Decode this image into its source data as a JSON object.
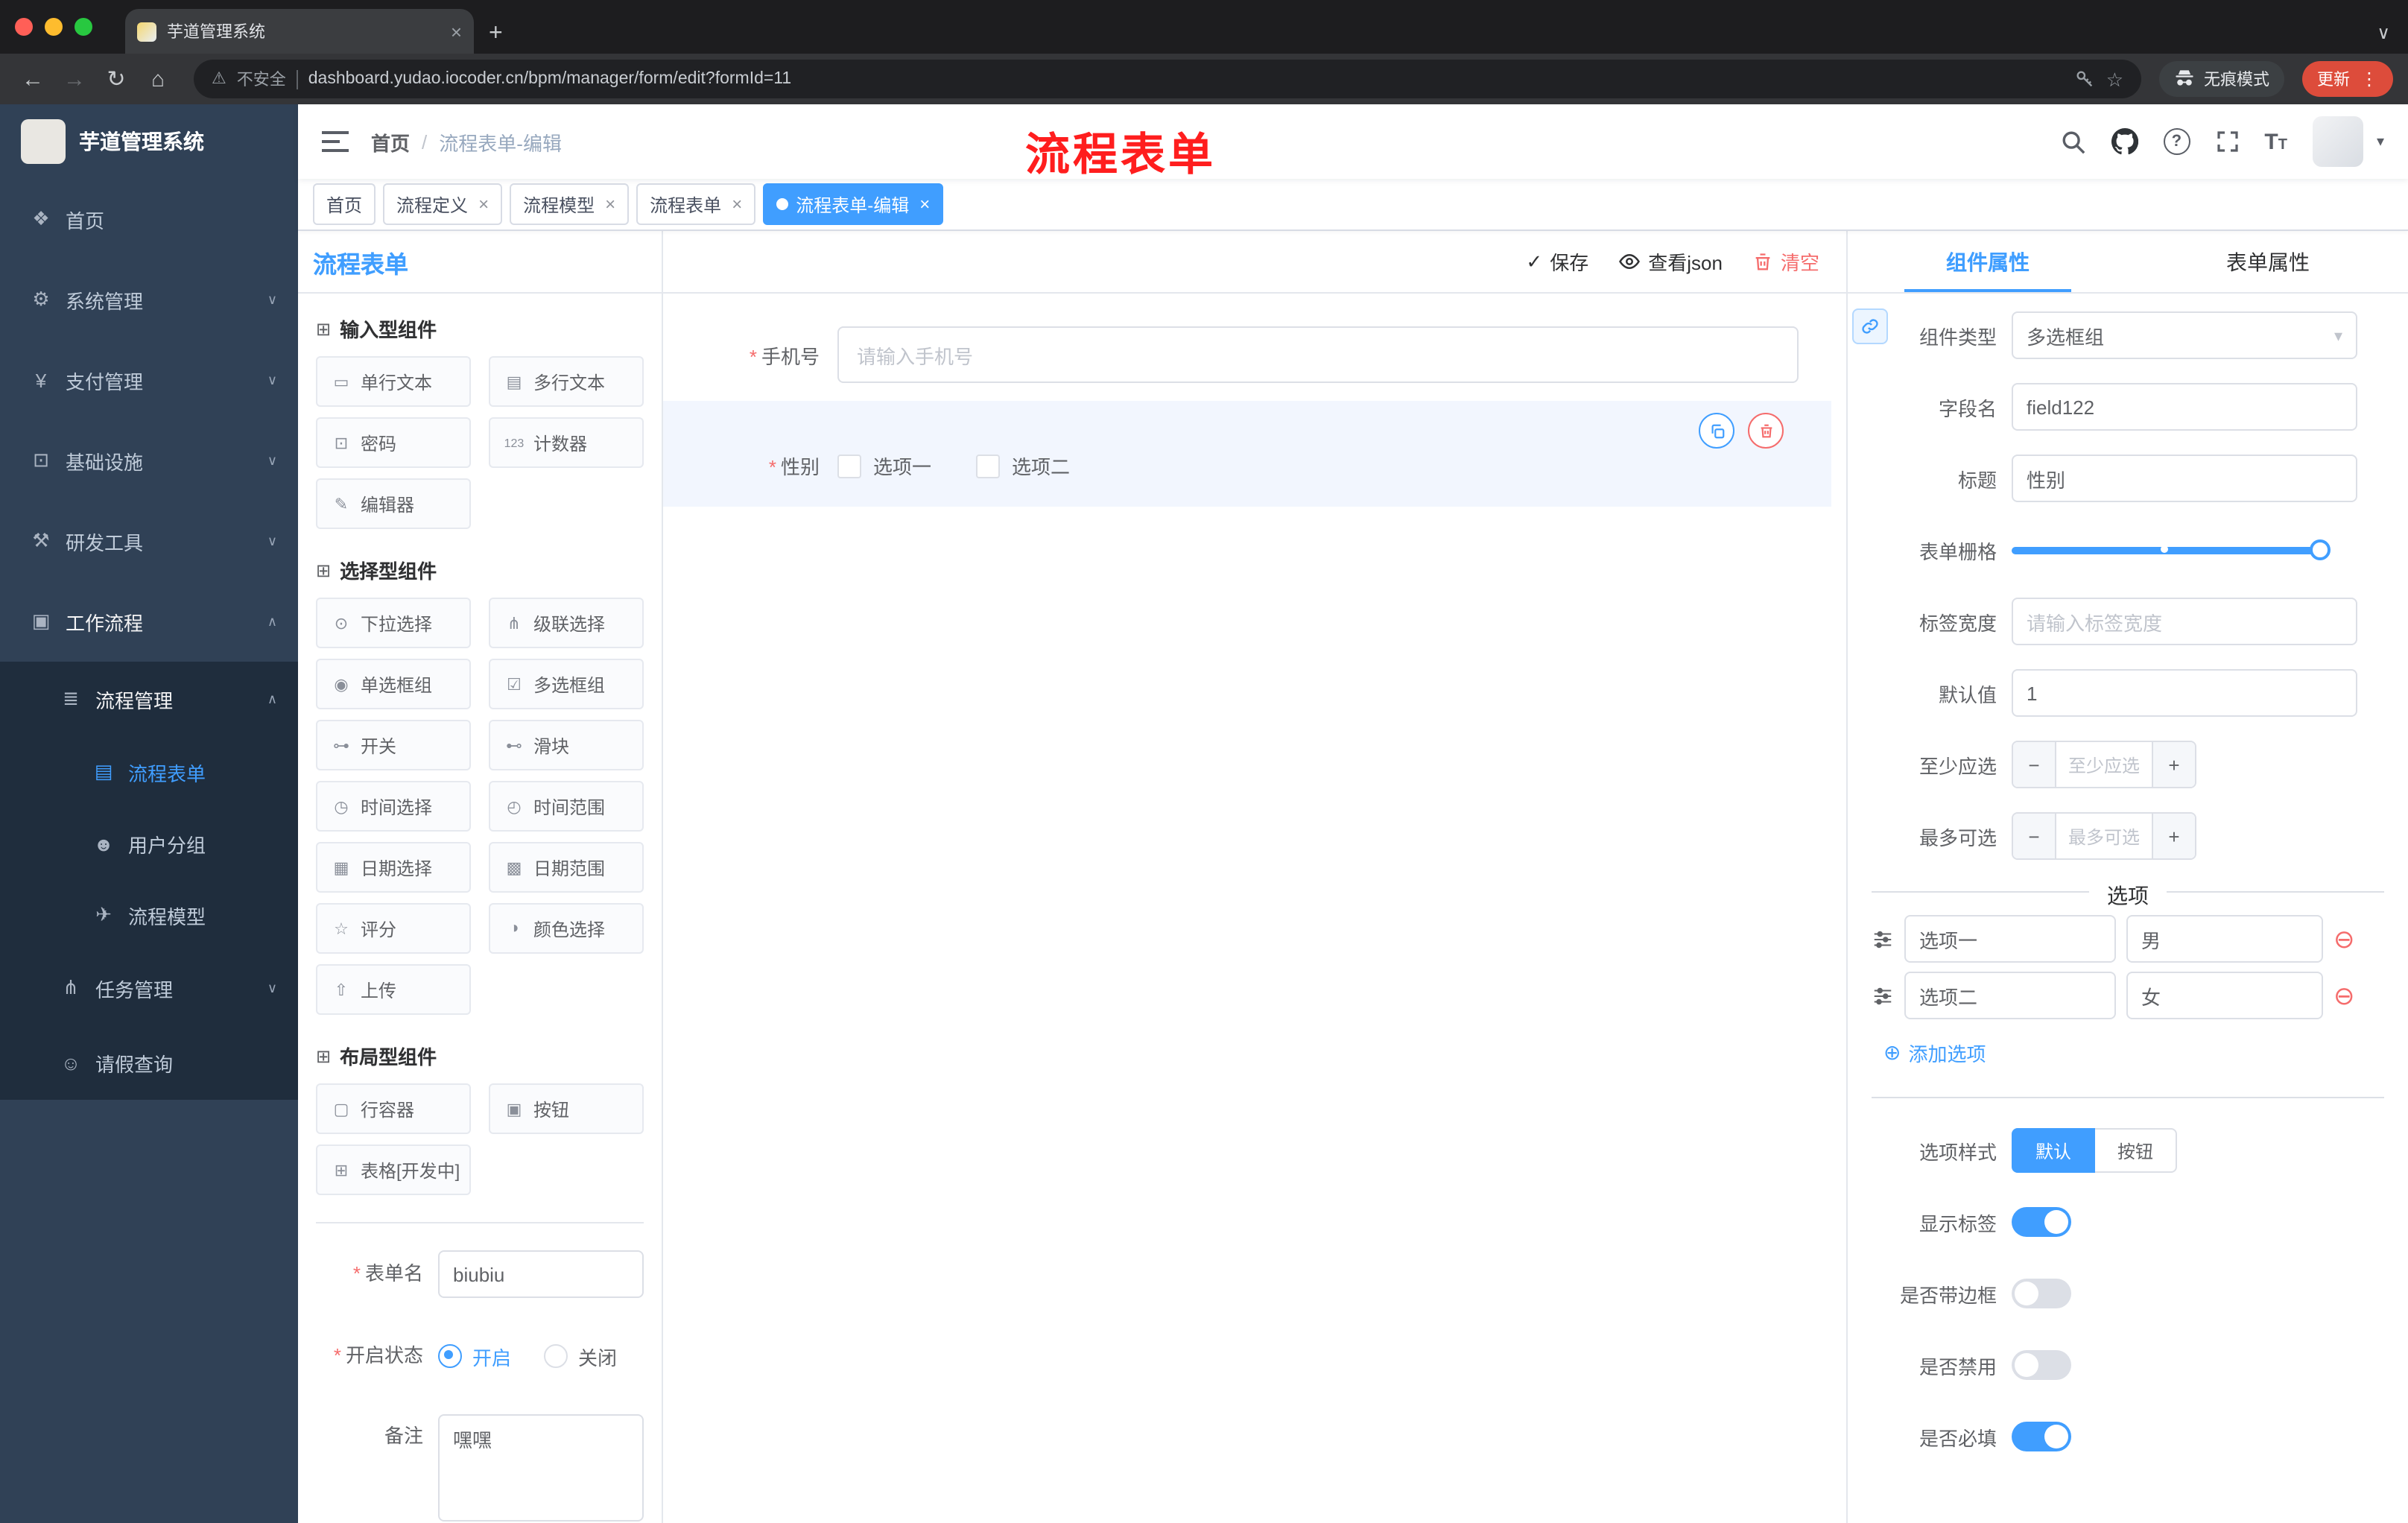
{
  "browser": {
    "tab_title": "芋道管理系统",
    "security_label": "不安全",
    "url": "dashboard.yudao.iocoder.cn/bpm/manager/form/edit?formId=11",
    "incognito_label": "无痕模式",
    "update_label": "更新"
  },
  "icons": {
    "back": "←",
    "forward": "→",
    "reload": "↻",
    "home": "⌂",
    "warning": "⚠",
    "star": "☆",
    "tab_search": "∨",
    "menu_dots": "⋮",
    "close": "×",
    "plus": "+",
    "minus": "−",
    "check": "✓",
    "caret_down": "▾",
    "question": "?",
    "text_size_big": "T",
    "text_size_small": "T",
    "add_circle": "⊕",
    "remove_circle": "⊖",
    "section": "⊞",
    "breadcrumb_sep": "/",
    "required": "*"
  },
  "watermark": "流程表单",
  "sidebar": {
    "logo_title": "芋道管理系统",
    "menu": [
      {
        "label": "首页",
        "icon": "❖",
        "arrow": ""
      },
      {
        "label": "系统管理",
        "icon": "⚙",
        "arrow": "∨"
      },
      {
        "label": "支付管理",
        "icon": "¥",
        "arrow": "∨"
      },
      {
        "label": "基础设施",
        "icon": "⊡",
        "arrow": "∨"
      },
      {
        "label": "研发工具",
        "icon": "⚒",
        "arrow": "∨"
      },
      {
        "label": "工作流程",
        "icon": "▣",
        "arrow": "∧"
      },
      {
        "label": "流程管理",
        "icon": "≣",
        "arrow": "∧"
      },
      {
        "label": "流程表单",
        "icon": "▤",
        "arrow": ""
      },
      {
        "label": "用户分组",
        "icon": "☻",
        "arrow": ""
      },
      {
        "label": "流程模型",
        "icon": "✈",
        "arrow": ""
      },
      {
        "label": "任务管理",
        "icon": "⋔",
        "arrow": "∨"
      },
      {
        "label": "请假查询",
        "icon": "☺",
        "arrow": ""
      }
    ]
  },
  "header": {
    "breadcrumb": {
      "home": "首页",
      "current": "流程表单-编辑"
    }
  },
  "tags": [
    {
      "label": "首页"
    },
    {
      "label": "流程定义"
    },
    {
      "label": "流程模型"
    },
    {
      "label": "流程表单"
    },
    {
      "label": "流程表单-编辑"
    }
  ],
  "palette": {
    "title": "流程表单",
    "input_section": "输入型组件",
    "input_items": [
      {
        "label": "单行文本",
        "icon": "▭"
      },
      {
        "label": "多行文本",
        "icon": "▤"
      },
      {
        "label": "密码",
        "icon": "⊡"
      },
      {
        "label": "计数器",
        "icon": "123"
      },
      {
        "label": "编辑器",
        "icon": "✎"
      }
    ],
    "select_section": "选择型组件",
    "select_items": [
      {
        "label": "下拉选择",
        "icon": "⊙"
      },
      {
        "label": "级联选择",
        "icon": "⋔"
      },
      {
        "label": "单选框组",
        "icon": "◉"
      },
      {
        "label": "多选框组",
        "icon": "☑"
      },
      {
        "label": "开关",
        "icon": "⊶"
      },
      {
        "label": "滑块",
        "icon": "⊷"
      },
      {
        "label": "时间选择",
        "icon": "◷"
      },
      {
        "label": "时间范围",
        "icon": "◴"
      },
      {
        "label": "日期选择",
        "icon": "▦"
      },
      {
        "label": "日期范围",
        "icon": "▩"
      },
      {
        "label": "评分",
        "icon": "☆"
      },
      {
        "label": "颜色选择",
        "icon": "◑"
      },
      {
        "label": "上传",
        "icon": "⇧"
      }
    ],
    "layout_section": "布局型组件",
    "layout_items": [
      {
        "label": "行容器",
        "icon": "▢"
      },
      {
        "label": "按钮",
        "icon": "▣"
      },
      {
        "label": "表格[开发中]",
        "icon": "⊞"
      }
    ],
    "meta": {
      "name_label": "表单名",
      "name_value": "biubiu",
      "status_label": "开启状态",
      "status_on": "开启",
      "status_off": "关闭",
      "remark_label": "备注",
      "remark_value": "嘿嘿"
    }
  },
  "canvas": {
    "save": "保存",
    "view_json": "查看json",
    "clear": "清空",
    "fields": {
      "phone_label": "手机号",
      "phone_placeholder": "请输入手机号",
      "gender_label": "性别",
      "gender_option1": "选项一",
      "gender_option2": "选项二"
    }
  },
  "props": {
    "tab_component": "组件属性",
    "tab_form": "表单属性",
    "type_label": "组件类型",
    "type_value": "多选框组",
    "field_label": "字段名",
    "field_value": "field122",
    "title_label": "标题",
    "title_value": "性别",
    "grid_label": "表单栅格",
    "label_width_label": "标签宽度",
    "label_width_placeholder": "请输入标签宽度",
    "default_label": "默认值",
    "default_value": "1",
    "min_label": "至少应选",
    "min_placeholder": "至少应选",
    "max_label": "最多可选",
    "max_placeholder": "最多可选",
    "options_title": "选项",
    "options": [
      {
        "label": "选项一",
        "value": "男"
      },
      {
        "label": "选项二",
        "value": "女"
      }
    ],
    "add_option": "添加选项",
    "style_label": "选项样式",
    "style_options": [
      {
        "label": "默认"
      },
      {
        "label": "按钮"
      }
    ],
    "switches": [
      {
        "label": "显示标签",
        "on": true
      },
      {
        "label": "是否带边框",
        "on": false
      },
      {
        "label": "是否禁用",
        "on": false
      },
      {
        "label": "是否必填",
        "on": true
      }
    ]
  },
  "colors": {
    "accent": "#409eff",
    "danger": "#f56c6c",
    "sidebar_bg": "#304156",
    "submenu_bg": "#1f2d3d",
    "tag_active_bg": "#409eff",
    "watermark_red": "#ff1e1e",
    "update_button_bg": "#dd4c3b"
  }
}
